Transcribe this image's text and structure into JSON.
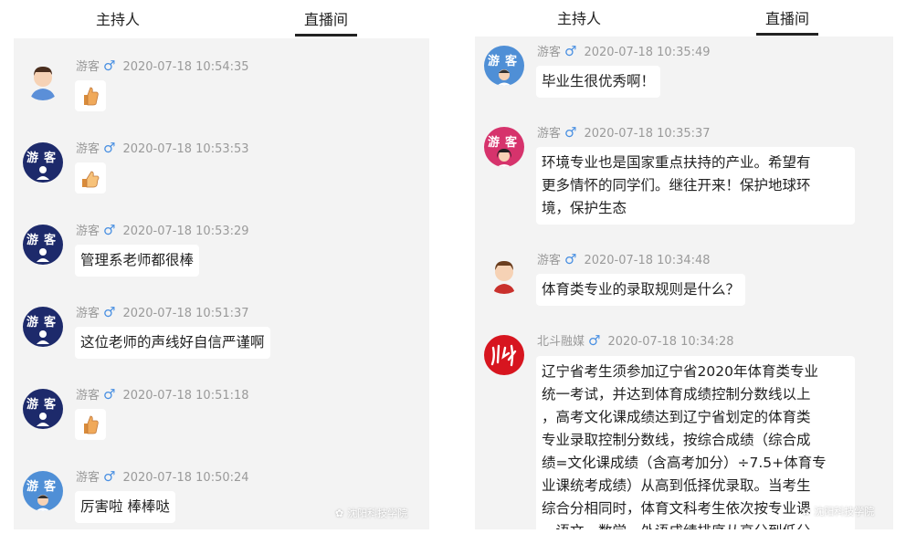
{
  "left": {
    "tabs": [
      "主持人",
      "直播间"
    ],
    "active_tab": 1,
    "messages": [
      {
        "user": "游客",
        "gender": "♂",
        "time": "2020-07-18 10:54:35",
        "type": "emoji",
        "emoji": "thumbs-up-icon",
        "avatar": "cartoon-man-avatar"
      },
      {
        "user": "游客",
        "gender": "♂",
        "time": "2020-07-18 10:53:53",
        "type": "emoji",
        "emoji": "thumbs-up-icon",
        "avatar": "guest-badge-avatar"
      },
      {
        "user": "游客",
        "gender": "♂",
        "time": "2020-07-18 10:53:29",
        "type": "text",
        "text": "管理系老师都很棒",
        "avatar": "guest-badge-avatar"
      },
      {
        "user": "游客",
        "gender": "♂",
        "time": "2020-07-18 10:51:37",
        "type": "text",
        "text": "这位老师的声线好自信严谨啊",
        "avatar": "guest-badge-avatar"
      },
      {
        "user": "游客",
        "gender": "♂",
        "time": "2020-07-18 10:51:18",
        "type": "emoji",
        "emoji": "thumbs-up-icon",
        "avatar": "guest-badge-avatar"
      },
      {
        "user": "游客",
        "gender": "♂",
        "time": "2020-07-18 10:50:24",
        "type": "text",
        "text": "厉害啦 棒棒哒",
        "avatar": "guest-light-avatar"
      }
    ],
    "watermark": "沈阳科技学院"
  },
  "right": {
    "tabs": [
      "主持人",
      "直播间"
    ],
    "active_tab": 1,
    "messages": [
      {
        "user": "游客",
        "gender": "♂",
        "time": "2020-07-18 10:35:49",
        "type": "text",
        "lines": [
          "毕业生很优秀啊！"
        ],
        "avatar": "guest-light-avatar"
      },
      {
        "user": "游客",
        "gender": "♂",
        "time": "2020-07-18 10:35:37",
        "type": "text",
        "lines": [
          "环境专业也是国家重点扶持的产业。希望有",
          "更多情怀的同学们。继往开来！保护地球环",
          "境，保护生态"
        ],
        "avatar": "guest-pink-avatar"
      },
      {
        "user": "游客",
        "gender": "♂",
        "time": "2020-07-18 10:34:48",
        "type": "text",
        "lines": [
          "体育类专业的录取规则是什么？"
        ],
        "avatar": "cartoon-boy-avatar"
      },
      {
        "user": "北斗融媒",
        "gender": "♂",
        "time": "2020-07-18 10:34:28",
        "type": "text",
        "lines": [
          "辽宁省考生须参加辽宁省2020年体育类专业",
          "统一考试，并达到体育成绩控制分数线以上",
          "，高考文化课成绩达到辽宁省划定的体育类",
          "专业录取控制分数线，按综合成绩（综合成",
          "绩=文化课成绩（含高考加分）÷7.5+体育专",
          "业课统考成绩）从高到低择优录取。当考生",
          "综合分相同时，体育文科考生依次按专业课",
          "、语文、数学、外语成绩排序从高分到低分"
        ],
        "avatar": "beidou-logo-avatar"
      }
    ],
    "watermark": "沈阳科技学院"
  },
  "colors": {
    "gender": "#4a90e2",
    "feed_bg": "#f3f3f3",
    "guest_dark": "#1d2a6b",
    "guest_light": "#4f8fd6",
    "guest_pink": "#d6336c",
    "beidou_red": "#d7151f"
  }
}
